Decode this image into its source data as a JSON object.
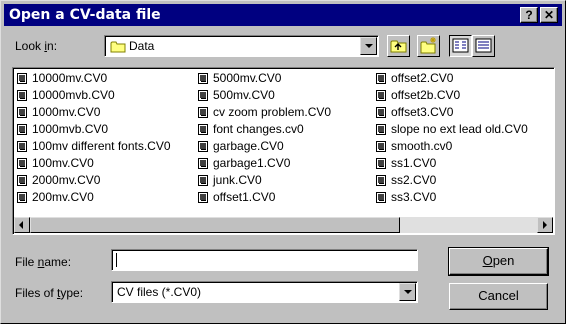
{
  "window": {
    "title": "Open a CV-data file",
    "help_label": "?",
    "close_label": "✕"
  },
  "look_in": {
    "label_pre": "Look ",
    "label_underlined": "i",
    "label_post": "n:",
    "value": "Data"
  },
  "toolbar": {
    "up_icon": "up-one-level-icon",
    "new_folder_icon": "new-folder-icon",
    "list_view_icon": "list-view-icon",
    "details_view_icon": "details-view-icon"
  },
  "files": {
    "columns": [
      [
        "10000mv.CV0",
        "10000mvb.CV0",
        "1000mv.CV0",
        "1000mvb.CV0",
        "100mv different fonts.CV0",
        "100mv.CV0",
        "2000mv.CV0",
        "200mv.CV0"
      ],
      [
        "5000mv.CV0",
        "500mv.CV0",
        "cv zoom problem.CV0",
        "font changes.cv0",
        "garbage.CV0",
        "garbage1.CV0",
        "junk.CV0",
        "offset1.CV0"
      ],
      [
        "offset2.CV0",
        "offset2b.CV0",
        "offset3.CV0",
        "slope no ext lead old.CV0",
        "smooth.cv0",
        "ss1.CV0",
        "ss2.CV0",
        "ss3.CV0"
      ]
    ]
  },
  "file_name": {
    "label_pre": "File ",
    "label_underlined": "n",
    "label_post": "ame:",
    "value": ""
  },
  "file_type": {
    "label_pre": "Files of ",
    "label_underlined": "t",
    "label_post": "ype:",
    "value": "CV files (*.CV0)"
  },
  "buttons": {
    "open_underlined": "O",
    "open_rest": "pen",
    "cancel": "Cancel"
  }
}
